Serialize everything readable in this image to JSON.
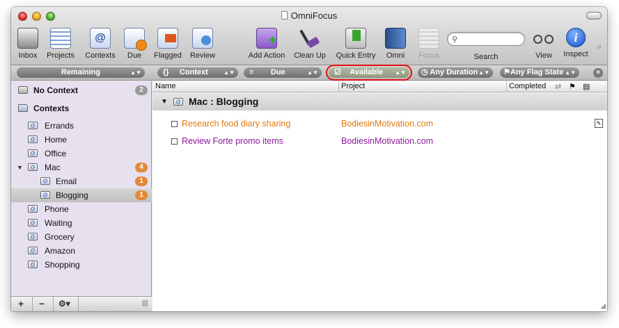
{
  "window": {
    "title": "OmniFocus"
  },
  "toolbar": {
    "items": [
      {
        "label": "Inbox",
        "icon": "inbox-tray-icon"
      },
      {
        "label": "Projects",
        "icon": "projects-list-icon"
      },
      {
        "label": "Contexts",
        "icon": "contexts-at-icon"
      },
      {
        "label": "Due",
        "icon": "due-clock-icon"
      },
      {
        "label": "Flagged",
        "icon": "flag-icon"
      },
      {
        "label": "Review",
        "icon": "review-icon"
      },
      {
        "label": "Add Action",
        "icon": "add-action-icon"
      },
      {
        "label": "Clean Up",
        "icon": "broom-icon"
      },
      {
        "label": "Quick Entry",
        "icon": "quick-entry-icon"
      },
      {
        "label": "Omni",
        "icon": "omni-book-icon"
      },
      {
        "label": "Focus",
        "icon": "focus-icon"
      },
      {
        "label": "Search",
        "icon": "search-icon"
      },
      {
        "label": "View",
        "icon": "view-glasses-icon"
      },
      {
        "label": "Inspect",
        "icon": "inspect-info-icon"
      }
    ]
  },
  "filterbar": {
    "sidebar_filter": "Remaining",
    "grouping": "Context",
    "sorting": "Due",
    "status": "Available",
    "duration": "Any Duration",
    "flag_state": "Any Flag State"
  },
  "sidebar": {
    "no_context": {
      "label": "No Context",
      "count": "2"
    },
    "contexts_header": "Contexts",
    "items": [
      {
        "label": "Errands"
      },
      {
        "label": "Home"
      },
      {
        "label": "Office"
      },
      {
        "label": "Mac",
        "count": "4"
      },
      {
        "label": "Email",
        "count": "1"
      },
      {
        "label": "Blogging",
        "count": "1"
      },
      {
        "label": "Phone"
      },
      {
        "label": "Waiting"
      },
      {
        "label": "Grocery"
      },
      {
        "label": "Amazon"
      },
      {
        "label": "Shopping"
      }
    ]
  },
  "columns": {
    "name": "Name",
    "project": "Project",
    "completed": "Completed"
  },
  "group": {
    "title": "Mac : Blogging"
  },
  "tasks": [
    {
      "name": "Research food diary sharing",
      "project": "BodiesinMotivation.com",
      "color": "#e07a10"
    },
    {
      "name": "Review Forte promo items",
      "project": "BodiesinMotivation.com",
      "color": "#8b1a9a"
    }
  ],
  "colors": {
    "sidebar_bg": "#e6e0ef",
    "highlight_ring": "#e01010",
    "badge_orange": "#e28a3a"
  }
}
